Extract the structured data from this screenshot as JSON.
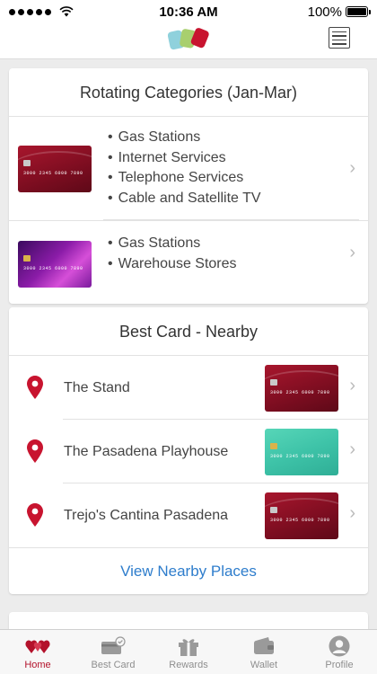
{
  "status_bar": {
    "time": "10:36 AM",
    "battery": "100%",
    "battery_level": 1.0
  },
  "rotating_card": {
    "title": "Rotating Categories (Jan-Mar)",
    "rows": [
      {
        "card_style": "red",
        "card_number": "3000 2345 6000 7890",
        "categories": [
          "Gas Stations",
          "Internet Services",
          "Telephone Services",
          "Cable and Satellite TV"
        ]
      },
      {
        "card_style": "purple",
        "card_number": "3000 2345 6000 7890",
        "categories": [
          "Gas Stations",
          "Warehouse Stores"
        ]
      }
    ]
  },
  "nearby_card": {
    "title": "Best Card - Nearby",
    "places": [
      {
        "name": "The Stand",
        "card_style": "red",
        "card_number": "3000 2345 6000 7890"
      },
      {
        "name": "The Pasadena Playhouse",
        "card_style": "teal",
        "card_number": "3000 2345 6000 7890"
      },
      {
        "name": "Trejo's Cantina Pasadena",
        "card_style": "red",
        "card_number": "3000 2345 6000 7890"
      }
    ],
    "link_label": "View Nearby Places"
  },
  "tabs": [
    {
      "label": "Home",
      "icon": "hearts-logo-icon",
      "active": true
    },
    {
      "label": "Best Card",
      "icon": "credit-card-check-icon",
      "active": false
    },
    {
      "label": "Rewards",
      "icon": "gift-icon",
      "active": false
    },
    {
      "label": "Wallet",
      "icon": "wallet-icon",
      "active": false
    },
    {
      "label": "Profile",
      "icon": "person-icon",
      "active": false
    }
  ],
  "colors": {
    "accent": "#b3122b",
    "link": "#2e7dcc",
    "background": "#ececec"
  }
}
